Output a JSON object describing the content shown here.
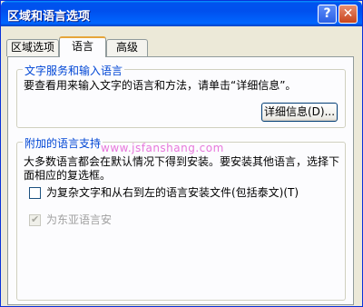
{
  "window": {
    "title": "区域和语言选项",
    "help_label": "?",
    "close_label": "✕"
  },
  "tabs": [
    {
      "label": "区域选项"
    },
    {
      "label": "语言"
    },
    {
      "label": "高级"
    }
  ],
  "text_services": {
    "legend": "文字服务和输入语言",
    "description": "要查看用来输入文字的语言和方法，请单击“详细信息”。",
    "details_button": "详细信息(D)..."
  },
  "supplemental": {
    "legend": "附加的语言支持",
    "description": "大多数语言都会在默认情况下得到安装。要安装其他语言，选择下面相应的复选框。",
    "complex_script_label": "为复杂文字和从右到左的语言安装文件(包括泰文)(T)",
    "complex_script_checked": false,
    "east_asian_label": "为东亚语言安",
    "east_asian_checked": true,
    "east_asian_enabled": false
  },
  "watermark": "www.jsfanshang.com"
}
